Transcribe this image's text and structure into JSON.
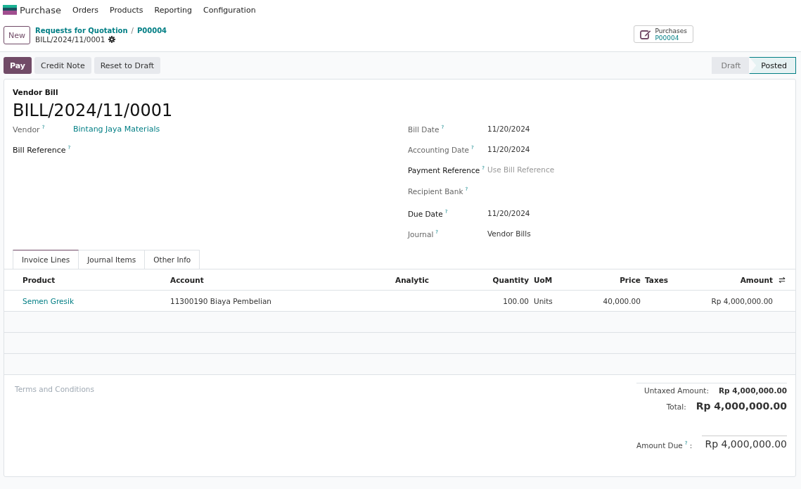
{
  "navbar": {
    "app": "Purchase",
    "menus": [
      "Orders",
      "Products",
      "Reporting",
      "Configuration"
    ]
  },
  "control_panel": {
    "new_button": "New",
    "breadcrumbs": [
      "Requests for Quotation",
      "P00004"
    ],
    "breadcrumb_separator": "/",
    "record": "BILL/2024/11/0001",
    "smart_button": {
      "label": "Purchases",
      "value": "P00004"
    }
  },
  "actions": [
    {
      "label": "Pay",
      "primary": true
    },
    {
      "label": "Credit Note",
      "primary": false
    },
    {
      "label": "Reset to Draft",
      "primary": false
    }
  ],
  "statusbar": [
    {
      "label": "Draft",
      "selected": false
    },
    {
      "label": "Posted",
      "selected": true
    }
  ],
  "form": {
    "type_label": "Vendor Bill",
    "name": "BILL/2024/11/0001",
    "left_fields": [
      {
        "label": "Vendor",
        "help": "?",
        "required": false,
        "value": "Bintang Jaya Materials",
        "link": true
      },
      {
        "label": "Bill Reference",
        "help": "?",
        "required": true
      }
    ],
    "right_fields": [
      {
        "label": "Bill Date",
        "help": "?",
        "required": false,
        "value": "11/20/2024",
        "link": false
      },
      {
        "label": "Accounting Date",
        "help": "?",
        "required": false,
        "value": "11/20/2024",
        "link": false
      },
      {
        "label": "Payment Reference",
        "help": "?",
        "required": true,
        "placeholder": "Use Bill Reference"
      },
      {
        "label": "Recipient Bank",
        "help": "?",
        "required": false
      },
      {
        "label": "Due Date",
        "help": "?",
        "required": true,
        "value": "11/20/2024",
        "link": false
      },
      {
        "label": "Journal",
        "help": "?",
        "required": false,
        "value": "Vendor Bills",
        "link": false
      }
    ]
  },
  "tabs": [
    {
      "label": "Invoice Lines",
      "selected": true
    },
    {
      "label": "Journal Items",
      "selected": false
    },
    {
      "label": "Other Info",
      "selected": false
    }
  ],
  "table": {
    "columns": [
      "Product",
      "Account",
      "Analytic",
      "Quantity",
      "UoM",
      "Price",
      "Taxes",
      "Amount"
    ],
    "rows": [
      [
        "Semen Gresik",
        "11300190 Biaya Pembelian",
        "",
        "100.00",
        "Units",
        "40,000.00",
        "",
        "Rp 4,000,000.00"
      ]
    ]
  },
  "terms_placeholder": "Terms and Conditions",
  "totals": {
    "untaxed_label": "Untaxed Amount:",
    "untaxed": "Rp 4,000,000.00",
    "total_label": "Total:",
    "total": "Rp 4,000,000.00",
    "due_label": "Amount Due",
    "due_help": "?",
    "due_colon": ":",
    "due": "Rp 4,000,000.00"
  }
}
